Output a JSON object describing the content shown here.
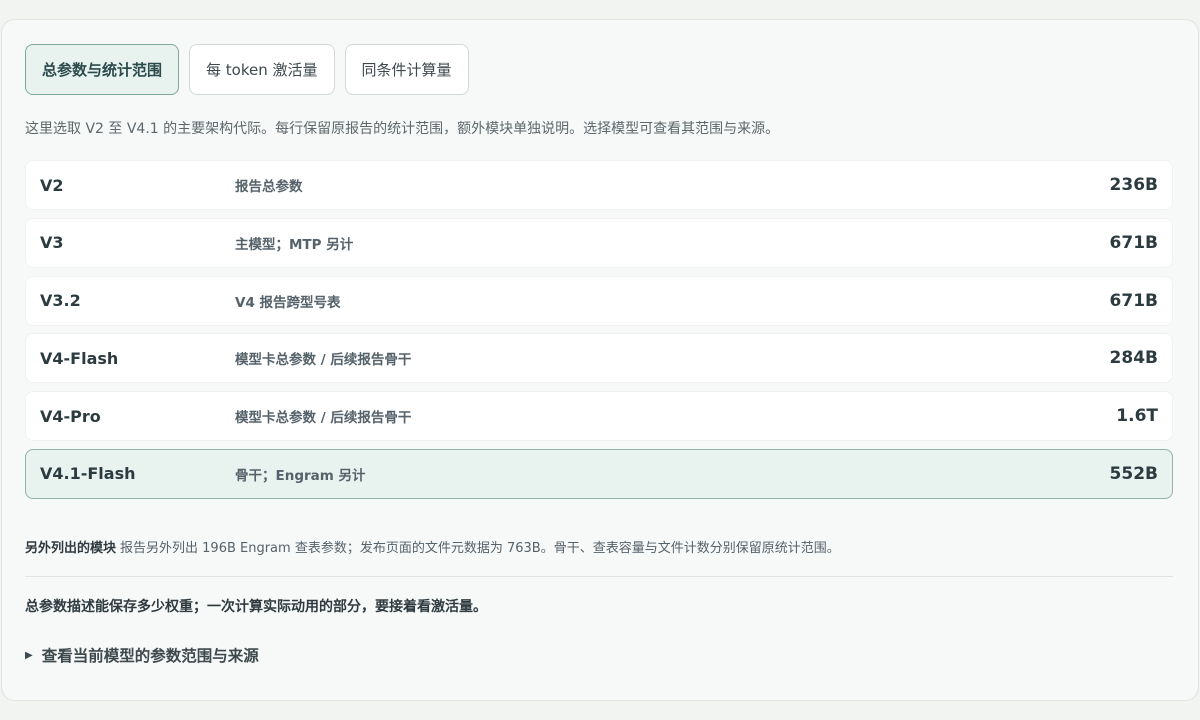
{
  "tabs": [
    {
      "label": "总参数与统计范围",
      "active": true
    },
    {
      "label": "每 token 激活量",
      "active": false
    },
    {
      "label": "同条件计算量",
      "active": false
    }
  ],
  "description": "这里选取 V2 至 V4.1 的主要架构代际。每行保留原报告的统计范围，额外模块单独说明。选择模型可查看其范围与来源。",
  "rows": [
    {
      "model": "V2",
      "scope": "报告总参数",
      "value": "236B",
      "selected": false
    },
    {
      "model": "V3",
      "scope": "主模型；MTP 另计",
      "value": "671B",
      "selected": false
    },
    {
      "model": "V3.2",
      "scope": "V4 报告跨型号表",
      "value": "671B",
      "selected": false
    },
    {
      "model": "V4-Flash",
      "scope": "模型卡总参数 / 后续报告骨干",
      "value": "284B",
      "selected": false
    },
    {
      "model": "V4-Pro",
      "scope": "模型卡总参数 / 后续报告骨干",
      "value": "1.6T",
      "selected": false
    },
    {
      "model": "V4.1-Flash",
      "scope": "骨干；Engram 另计",
      "value": "552B",
      "selected": true
    }
  ],
  "note": {
    "label": "另外列出的模块",
    "text": "报告另外列出 196B Engram 查表参数；发布页面的文件元数据为 763B。骨干、查表容量与文件计数分别保留原统计范围。"
  },
  "summary": "总参数描述能保存多少权重；一次计算实际动用的部分，要接着看激活量。",
  "details": {
    "icon": "disclosure-triangle-icon",
    "label": "查看当前模型的参数范围与来源"
  },
  "colors": {
    "accent_bg": "#e8f3ef",
    "accent_border": "#7fa89a"
  }
}
